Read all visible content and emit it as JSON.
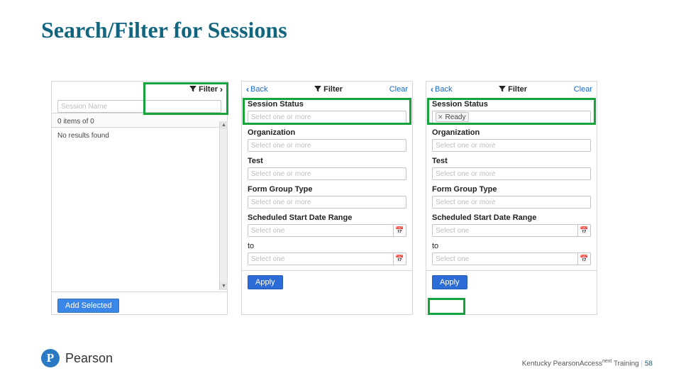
{
  "title": "Search/Filter for Sessions",
  "panel1": {
    "filter_toggle": "Filter",
    "search_placeholder": "Session Name",
    "count": "0 items of 0",
    "no_results": "No results found",
    "add_selected_label": "Add Selected"
  },
  "panel2": {
    "back": "Back",
    "title": "Filter",
    "clear": "Clear",
    "labels": {
      "session_status": "Session Status",
      "organization": "Organization",
      "test": "Test",
      "form_group_type": "Form Group Type",
      "scheduled_range": "Scheduled Start Date Range",
      "to": "to"
    },
    "placeholders": {
      "multi": "Select one or more",
      "single": "Select one"
    },
    "apply": "Apply"
  },
  "panel3": {
    "back": "Back",
    "title": "Filter",
    "clear": "Clear",
    "labels": {
      "session_status": "Session Status",
      "organization": "Organization",
      "test": "Test",
      "form_group_type": "Form Group Type",
      "scheduled_range": "Scheduled Start Date Range",
      "to": "to"
    },
    "placeholders": {
      "multi": "Select one or more",
      "single": "Select one"
    },
    "status_chip": "Ready",
    "apply": "Apply"
  },
  "footer": {
    "brand": "Pearson",
    "right_prefix": "Kentucky PearsonAccess",
    "right_suffix": " Training ",
    "page_label": "58"
  }
}
